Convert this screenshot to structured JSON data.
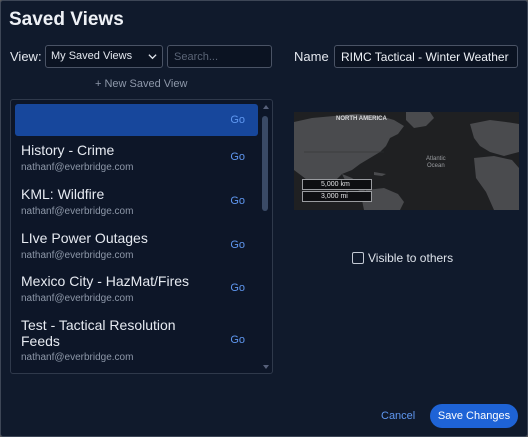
{
  "dialog": {
    "title": "Saved Views"
  },
  "filter": {
    "view_label": "View:",
    "view_selected": "My Saved Views",
    "search_placeholder": "Search..."
  },
  "new_saved_view_label": "+ New Saved View",
  "saved_views": [
    {
      "title": "",
      "owner": "",
      "go": "Go",
      "selected": true
    },
    {
      "title": "History - Crime",
      "owner": "nathanf@everbridge.com",
      "go": "Go"
    },
    {
      "title": "KML: Wildfire",
      "owner": "nathanf@everbridge.com",
      "go": "Go"
    },
    {
      "title": "LIve Power Outages",
      "owner": "nathanf@everbridge.com",
      "go": "Go"
    },
    {
      "title": "Mexico City - HazMat/Fires",
      "owner": "nathanf@everbridge.com",
      "go": "Go"
    },
    {
      "title_line1": "Test - Tactical Resolution",
      "title_line2": "Feeds",
      "owner": "nathanf@everbridge.com",
      "go": "Go"
    }
  ],
  "name_field": {
    "label": "Name",
    "value": "RIMC Tactical - Winter Weather"
  },
  "map_preview": {
    "region_label": "NORTH AMERICA",
    "ocean_line1": "Atlantic",
    "ocean_line2": "Ocean",
    "scale_km": "5,000 km",
    "scale_mi": "3,000 mi"
  },
  "visible_to_others": {
    "label": "Visible to others",
    "checked": false
  },
  "footer": {
    "cancel_label": "Cancel",
    "save_label": "Save Changes"
  },
  "colors": {
    "background": "#101a2c",
    "accent": "#1e63d6",
    "selected_row": "#17479c",
    "link": "#5f97f0"
  }
}
